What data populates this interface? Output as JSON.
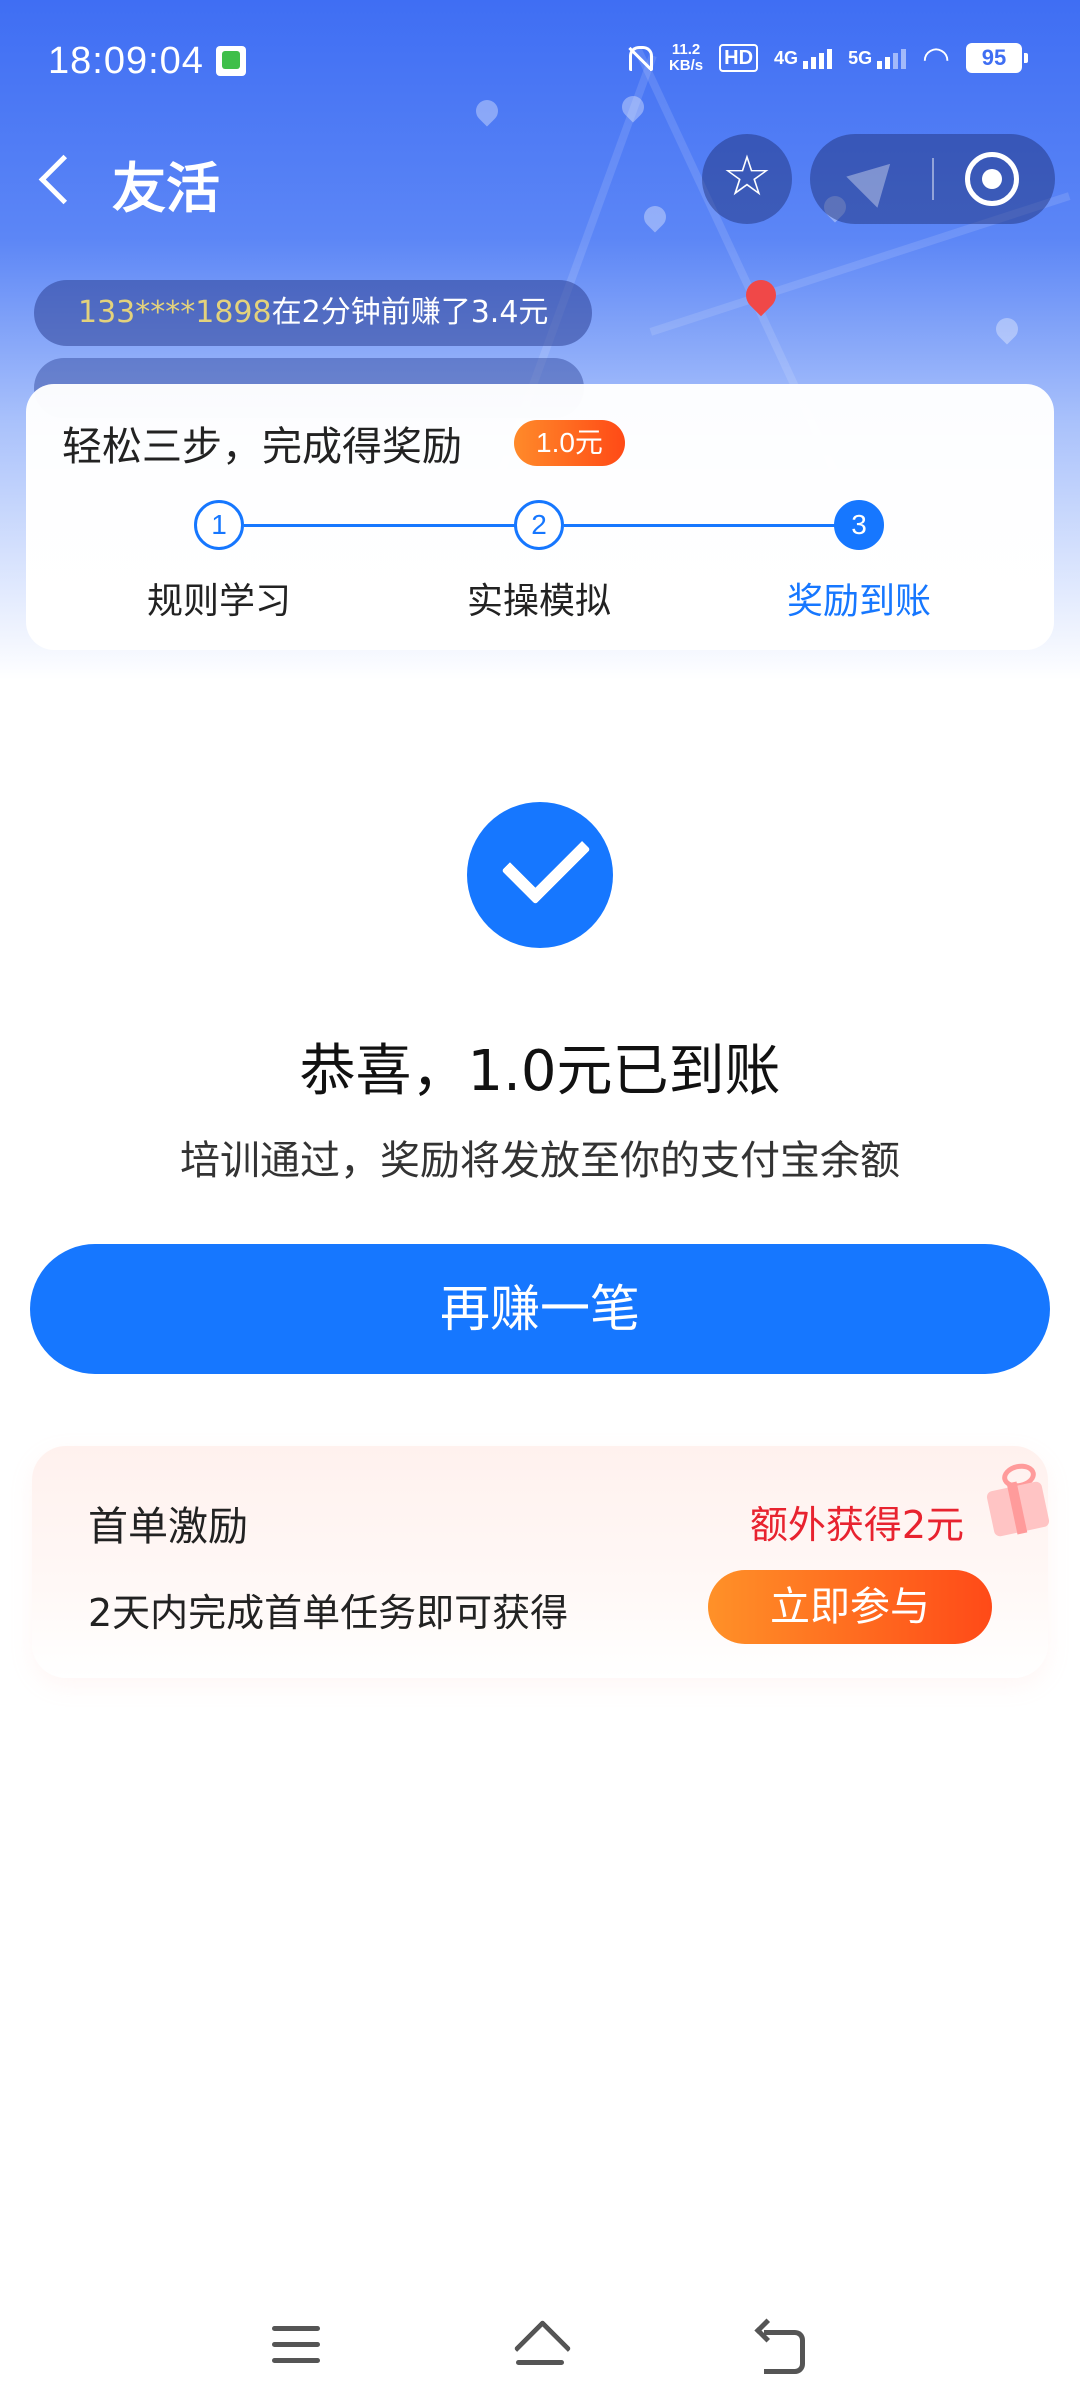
{
  "status_bar": {
    "time": "18:09:04",
    "net_speed_value": "11.2",
    "net_speed_unit": "KB/s",
    "hd_label": "HD",
    "signal_4g": "4G",
    "signal_5g": "5G",
    "battery": "95"
  },
  "nav": {
    "title": "友活"
  },
  "ticker": {
    "phone": "133****1898",
    "message": "在2分钟前赚了3.4元"
  },
  "steps": {
    "title": "轻松三步，完成得奖励",
    "reward_badge": "1.0元",
    "items": [
      {
        "number": "1",
        "label": "规则学习"
      },
      {
        "number": "2",
        "label": "实操模拟"
      },
      {
        "number": "3",
        "label": "奖励到账"
      }
    ]
  },
  "result": {
    "title": "恭喜，1.0元已到账",
    "subtitle": "培训通过，奖励将发放至你的支付宝余额",
    "button_label": "再赚一笔"
  },
  "bonus": {
    "title": "首单激励",
    "extra": "额外获得2元",
    "description": "2天内完成首单任务即可获得",
    "button_label": "立即参与"
  },
  "colors": {
    "primary": "#1677ff",
    "accent_orange": "#ff6a1f",
    "accent_red": "#e8232f"
  }
}
